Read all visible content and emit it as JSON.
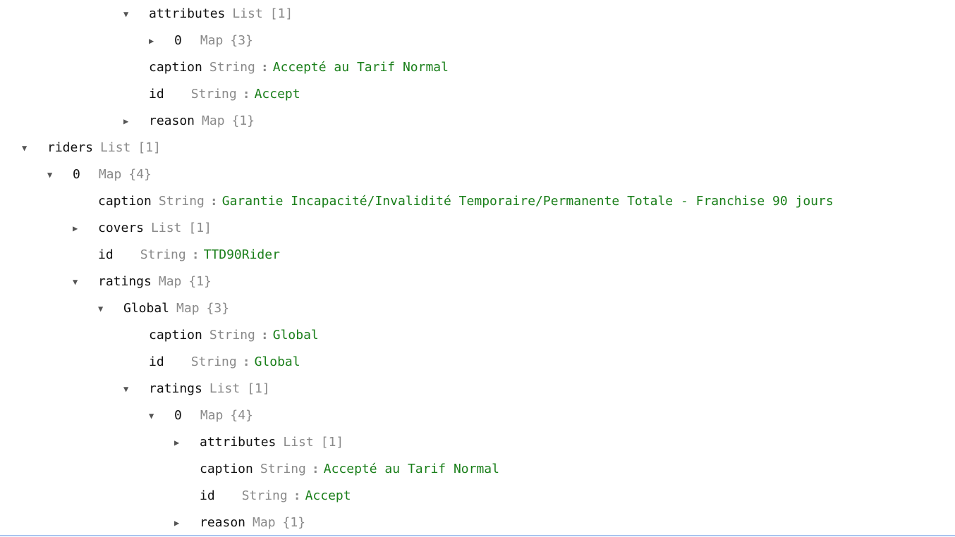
{
  "rows": [
    {
      "key": "attributes",
      "type": "List",
      "count": "[1]",
      "expanded": true
    },
    {
      "key": "0",
      "type": "Map",
      "count": "{3}",
      "expanded": false
    },
    {
      "key": "caption",
      "type": "String",
      "value": "Accepté au Tarif Normal"
    },
    {
      "key": "id",
      "type": "String",
      "value": "Accept"
    },
    {
      "key": "reason",
      "type": "Map",
      "count": "{1}",
      "expanded": false
    },
    {
      "key": "riders",
      "type": "List",
      "count": "[1]",
      "expanded": true
    },
    {
      "key": "0",
      "type": "Map",
      "count": "{4}",
      "expanded": true
    },
    {
      "key": "caption",
      "type": "String",
      "value": "Garantie Incapacité/Invalidité Temporaire/Permanente Totale - Franchise 90 jours"
    },
    {
      "key": "covers",
      "type": "List",
      "count": "[1]",
      "expanded": false
    },
    {
      "key": "id",
      "type": "String",
      "value": "TTD90Rider"
    },
    {
      "key": "ratings",
      "type": "Map",
      "count": "{1}",
      "expanded": true
    },
    {
      "key": "Global",
      "type": "Map",
      "count": "{3}",
      "expanded": true
    },
    {
      "key": "caption",
      "type": "String",
      "value": "Global"
    },
    {
      "key": "id",
      "type": "String",
      "value": "Global"
    },
    {
      "key": "ratings",
      "type": "List",
      "count": "[1]",
      "expanded": true
    },
    {
      "key": "0",
      "type": "Map",
      "count": "{4}",
      "expanded": true
    },
    {
      "key": "attributes",
      "type": "List",
      "count": "[1]",
      "expanded": false
    },
    {
      "key": "caption",
      "type": "String",
      "value": "Accepté au Tarif Normal"
    },
    {
      "key": "id",
      "type": "String",
      "value": "Accept"
    },
    {
      "key": "reason",
      "type": "Map",
      "count": "{1}",
      "expanded": false
    }
  ],
  "icons": {
    "expanded": "▼",
    "collapsed": "▶"
  }
}
